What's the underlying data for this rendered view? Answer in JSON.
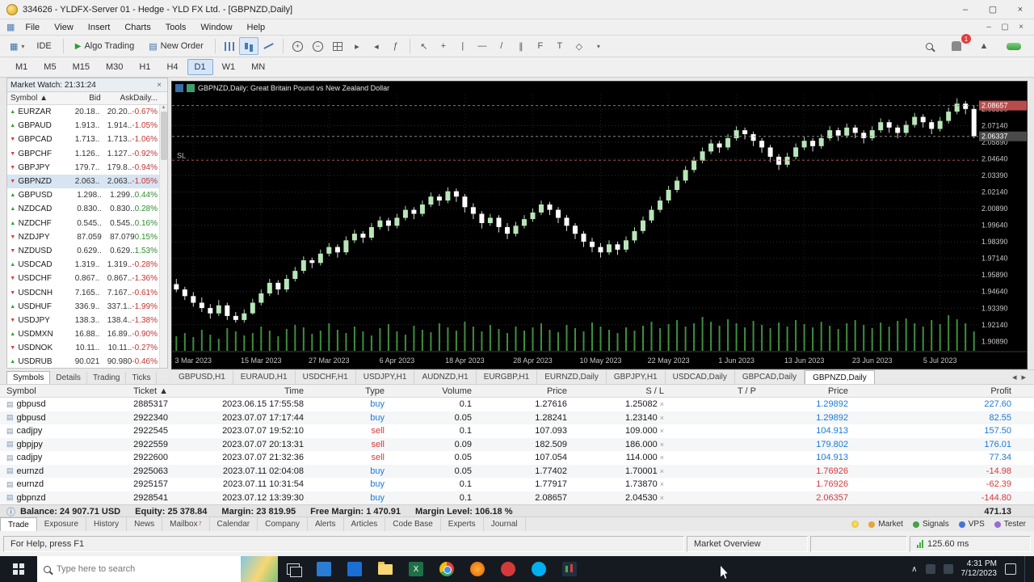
{
  "window": {
    "title": "334626 - YLDFX-Server 01 - Hedge - YLD FX Ltd. - [GBPNZD,Daily]"
  },
  "icons": {
    "min": "–",
    "max": "▢",
    "close": "×",
    "dropdown": "▾",
    "up": "▲",
    "down": "▼",
    "left": "◂",
    "right": "▸",
    "cursor": "↖",
    "cross": "+",
    "vline": "|",
    "hline": "—",
    "trend": "/",
    "channel": "∥",
    "fibo": "F",
    "text": "T",
    "shapes": "◇",
    "chart_new": "▦",
    "order_doc": "▤",
    "play": "▶",
    "func": "ƒ",
    "chevron_up": "∧"
  },
  "menu": {
    "items": [
      "File",
      "View",
      "Insert",
      "Charts",
      "Tools",
      "Window",
      "Help"
    ]
  },
  "toolbar": {
    "ide_label": "IDE",
    "algo_label": "Algo Trading",
    "order_label": "New Order",
    "badge": "1"
  },
  "timeframes": {
    "items": [
      "M1",
      "M5",
      "M15",
      "M30",
      "H1",
      "H4",
      "D1",
      "W1",
      "MN"
    ],
    "active": "D1"
  },
  "market_watch": {
    "title": "Market Watch: 21:31:24",
    "columns": [
      "Symbol ▲",
      "Bid",
      "Ask",
      "Daily..."
    ],
    "selected": "GBPNZD",
    "rows": [
      {
        "symbol": "EURZAR",
        "bid": "20.18..",
        "ask": "20.20..",
        "daily": "-0.67%",
        "dir": "up"
      },
      {
        "symbol": "GBPAUD",
        "bid": "1.913..",
        "ask": "1.914..",
        "daily": "-1.05%",
        "dir": "up"
      },
      {
        "symbol": "GBPCAD",
        "bid": "1.713..",
        "ask": "1.713..",
        "daily": "-1.06%",
        "dir": "down"
      },
      {
        "symbol": "GBPCHF",
        "bid": "1.126..",
        "ask": "1.127..",
        "daily": "-0.92%",
        "dir": "down"
      },
      {
        "symbol": "GBPJPY",
        "bid": "179.7..",
        "ask": "179.8..",
        "daily": "-0.94%",
        "dir": "down"
      },
      {
        "symbol": "GBPNZD",
        "bid": "2.063..",
        "ask": "2.063..",
        "daily": "-1.05%",
        "dir": "down"
      },
      {
        "symbol": "GBPUSD",
        "bid": "1.298..",
        "ask": "1.299..",
        "daily": "0.44%",
        "dir": "up"
      },
      {
        "symbol": "NZDCAD",
        "bid": "0.830..",
        "ask": "0.830..",
        "daily": "0.28%",
        "dir": "up"
      },
      {
        "symbol": "NZDCHF",
        "bid": "0.545..",
        "ask": "0.545..",
        "daily": "0.16%",
        "dir": "up"
      },
      {
        "symbol": "NZDJPY",
        "bid": "87.059",
        "ask": "87.079",
        "daily": "0.15%",
        "dir": "down"
      },
      {
        "symbol": "NZDUSD",
        "bid": "0.629..",
        "ask": "0.629..",
        "daily": "1.53%",
        "dir": "down"
      },
      {
        "symbol": "USDCAD",
        "bid": "1.319..",
        "ask": "1.319..",
        "daily": "-0.28%",
        "dir": "up"
      },
      {
        "symbol": "USDCHF",
        "bid": "0.867..",
        "ask": "0.867..",
        "daily": "-1.36%",
        "dir": "down"
      },
      {
        "symbol": "USDCNH",
        "bid": "7.165..",
        "ask": "7.167..",
        "daily": "-0.61%",
        "dir": "down"
      },
      {
        "symbol": "USDHUF",
        "bid": "336.9..",
        "ask": "337.1..",
        "daily": "-1.99%",
        "dir": "up"
      },
      {
        "symbol": "USDJPY",
        "bid": "138.3..",
        "ask": "138.4..",
        "daily": "-1.38%",
        "dir": "down"
      },
      {
        "symbol": "USDMXN",
        "bid": "16.88..",
        "ask": "16.89..",
        "daily": "-0.90%",
        "dir": "up"
      },
      {
        "symbol": "USDNOK",
        "bid": "10.11..",
        "ask": "10.11..",
        "daily": "-0.27%",
        "dir": "down"
      },
      {
        "symbol": "USDRUB",
        "bid": "90.021",
        "ask": "90.980",
        "daily": "-0.46%",
        "dir": "up"
      }
    ],
    "tabs": [
      "Symbols",
      "Details",
      "Trading",
      "Ticks"
    ],
    "active_tab": "Symbols"
  },
  "chart": {
    "window_title": "GBPNZD,Daily:  Great Britain Pound vs New Zealand Dollar"
  },
  "chart_tabs": {
    "items": [
      "GBPUSD,H1",
      "EURAUD,H1",
      "USDCHF,H1",
      "USDJPY,H1",
      "AUDNZD,H1",
      "EURGBP,H1",
      "EURNZD,Daily",
      "GBPJPY,H1",
      "USDCAD,Daily",
      "GBPCAD,Daily",
      "GBPNZD,Daily"
    ],
    "active": "GBPNZD,Daily"
  },
  "chart_data": {
    "type": "candlestick",
    "title": "GBPNZD,Daily: Great Britain Pound vs New Zealand Dollar",
    "symbol": "GBPNZD",
    "period": "Daily",
    "xlabel": "",
    "ylabel": "",
    "ylim": [
      1.903,
      2.093
    ],
    "grid": true,
    "price_labels": [
      "2.08390",
      "2.07140",
      "2.05890",
      "2.04640",
      "2.03390",
      "2.02140",
      "2.00890",
      "1.99640",
      "1.98390",
      "1.97140",
      "1.95890",
      "1.94640",
      "1.93390",
      "1.92140",
      "1.90890"
    ],
    "date_labels": [
      {
        "i": 2,
        "t": "3 Mar 2023"
      },
      {
        "i": 10,
        "t": "15 Mar 2023"
      },
      {
        "i": 18,
        "t": "27 Mar 2023"
      },
      {
        "i": 26,
        "t": "6 Apr 2023"
      },
      {
        "i": 34,
        "t": "18 Apr 2023"
      },
      {
        "i": 42,
        "t": "28 Apr 2023"
      },
      {
        "i": 50,
        "t": "10 May 2023"
      },
      {
        "i": 58,
        "t": "22 May 2023"
      },
      {
        "i": 66,
        "t": "1 Jun 2023"
      },
      {
        "i": 74,
        "t": "13 Jun 2023"
      },
      {
        "i": 82,
        "t": "23 Jun 2023"
      },
      {
        "i": 90,
        "t": "5 Jul 2023"
      }
    ],
    "ohlc": [
      [
        1.952,
        1.956,
        1.946,
        1.948
      ],
      [
        1.948,
        1.95,
        1.94,
        1.943
      ],
      [
        1.943,
        1.946,
        1.935,
        1.938
      ],
      [
        1.938,
        1.942,
        1.931,
        1.934
      ],
      [
        1.934,
        1.937,
        1.926,
        1.93
      ],
      [
        1.93,
        1.94,
        1.928,
        1.936
      ],
      [
        1.936,
        1.938,
        1.925,
        1.928
      ],
      [
        1.928,
        1.931,
        1.923,
        1.925
      ],
      [
        1.925,
        1.933,
        1.923,
        1.93
      ],
      [
        1.93,
        1.941,
        1.929,
        1.938
      ],
      [
        1.938,
        1.948,
        1.936,
        1.945
      ],
      [
        1.945,
        1.956,
        1.943,
        1.953
      ],
      [
        1.953,
        1.955,
        1.944,
        1.948
      ],
      [
        1.948,
        1.959,
        1.946,
        1.956
      ],
      [
        1.956,
        1.965,
        1.954,
        1.962
      ],
      [
        1.962,
        1.973,
        1.96,
        1.97
      ],
      [
        1.97,
        1.972,
        1.964,
        1.968
      ],
      [
        1.968,
        1.978,
        1.966,
        1.975
      ],
      [
        1.975,
        1.983,
        1.973,
        1.98
      ],
      [
        1.98,
        1.982,
        1.972,
        1.976
      ],
      [
        1.976,
        1.988,
        1.974,
        1.985
      ],
      [
        1.985,
        1.993,
        1.983,
        1.99
      ],
      [
        1.99,
        1.992,
        1.983,
        1.987
      ],
      [
        1.987,
        1.998,
        1.985,
        1.995
      ],
      [
        1.995,
        2.003,
        1.993,
        2.0
      ],
      [
        2.0,
        2.002,
        1.992,
        1.996
      ],
      [
        1.996,
        2.005,
        1.994,
        2.002
      ],
      [
        2.002,
        2.011,
        2.0,
        2.008
      ],
      [
        2.008,
        2.01,
        2.001,
        2.005
      ],
      [
        2.005,
        2.015,
        2.003,
        2.012
      ],
      [
        2.012,
        2.021,
        2.01,
        2.018
      ],
      [
        2.018,
        2.02,
        2.011,
        2.015
      ],
      [
        2.015,
        2.025,
        2.013,
        2.022
      ],
      [
        2.022,
        2.024,
        2.014,
        2.018
      ],
      [
        2.018,
        2.02,
        2.006,
        2.01
      ],
      [
        2.01,
        2.013,
        2.001,
        2.005
      ],
      [
        2.005,
        2.007,
        1.994,
        1.998
      ],
      [
        1.998,
        2.005,
        1.996,
        2.002
      ],
      [
        2.002,
        2.004,
        1.991,
        1.995
      ],
      [
        1.995,
        1.998,
        1.986,
        1.99
      ],
      [
        1.99,
        1.999,
        1.988,
        1.996
      ],
      [
        1.996,
        2.004,
        1.994,
        2.001
      ],
      [
        2.001,
        2.009,
        1.999,
        2.006
      ],
      [
        2.006,
        2.015,
        2.004,
        2.012
      ],
      [
        2.012,
        2.014,
        2.004,
        2.008
      ],
      [
        2.008,
        2.01,
        1.998,
        2.002
      ],
      [
        2.002,
        2.004,
        1.992,
        1.996
      ],
      [
        1.996,
        1.998,
        1.986,
        1.99
      ],
      [
        1.99,
        1.992,
        1.98,
        1.984
      ],
      [
        1.984,
        1.987,
        1.976,
        1.98
      ],
      [
        1.98,
        1.983,
        1.972,
        1.976
      ],
      [
        1.976,
        1.985,
        1.974,
        1.982
      ],
      [
        1.982,
        1.984,
        1.974,
        1.978
      ],
      [
        1.978,
        1.988,
        1.976,
        1.985
      ],
      [
        1.985,
        1.995,
        1.983,
        1.992
      ],
      [
        1.992,
        2.003,
        1.99,
        2.0
      ],
      [
        2.0,
        2.011,
        1.998,
        2.008
      ],
      [
        2.008,
        2.018,
        2.006,
        2.015
      ],
      [
        2.015,
        2.026,
        2.013,
        2.023
      ],
      [
        2.023,
        2.033,
        2.021,
        2.03
      ],
      [
        2.03,
        2.041,
        2.028,
        2.038
      ],
      [
        2.038,
        2.048,
        2.036,
        2.045
      ],
      [
        2.045,
        2.055,
        2.043,
        2.052
      ],
      [
        2.052,
        2.061,
        2.05,
        2.058
      ],
      [
        2.058,
        2.06,
        2.051,
        2.055
      ],
      [
        2.055,
        2.065,
        2.053,
        2.062
      ],
      [
        2.062,
        2.071,
        2.06,
        2.068
      ],
      [
        2.068,
        2.07,
        2.061,
        2.065
      ],
      [
        2.065,
        2.067,
        2.056,
        2.06
      ],
      [
        2.06,
        2.062,
        2.051,
        2.055
      ],
      [
        2.055,
        2.057,
        2.044,
        2.048
      ],
      [
        2.048,
        2.05,
        2.038,
        2.042
      ],
      [
        2.042,
        2.051,
        2.04,
        2.048
      ],
      [
        2.048,
        2.058,
        2.046,
        2.055
      ],
      [
        2.055,
        2.063,
        2.053,
        2.06
      ],
      [
        2.06,
        2.062,
        2.052,
        2.056
      ],
      [
        2.056,
        2.065,
        2.054,
        2.062
      ],
      [
        2.062,
        2.071,
        2.06,
        2.068
      ],
      [
        2.068,
        2.07,
        2.06,
        2.064
      ],
      [
        2.064,
        2.073,
        2.062,
        2.07
      ],
      [
        2.07,
        2.072,
        2.062,
        2.066
      ],
      [
        2.066,
        2.068,
        2.058,
        2.062
      ],
      [
        2.062,
        2.071,
        2.06,
        2.068
      ],
      [
        2.068,
        2.077,
        2.066,
        2.074
      ],
      [
        2.074,
        2.076,
        2.066,
        2.07
      ],
      [
        2.07,
        2.072,
        2.062,
        2.066
      ],
      [
        2.066,
        2.075,
        2.064,
        2.072
      ],
      [
        2.072,
        2.081,
        2.07,
        2.078
      ],
      [
        2.078,
        2.08,
        2.07,
        2.074
      ],
      [
        2.074,
        2.076,
        2.065,
        2.069
      ],
      [
        2.069,
        2.078,
        2.067,
        2.075
      ],
      [
        2.075,
        2.085,
        2.073,
        2.082
      ],
      [
        2.082,
        2.092,
        2.08,
        2.088
      ],
      [
        2.088,
        2.09,
        2.08,
        2.084
      ],
      [
        2.084,
        2.087,
        2.062,
        2.0634
      ]
    ],
    "volumes": [
      900,
      1100,
      850,
      1300,
      1000,
      750,
      1400,
      1200,
      950,
      1100,
      1500,
      1250,
      900,
      1350,
      1600,
      1450,
      1050,
      1250,
      1700,
      1300,
      1100,
      1500,
      1200,
      950,
      1400,
      1650,
      1200,
      1000,
      1550,
      1300,
      1150,
      1700,
      1450,
      1250,
      1800,
      1500,
      1200,
      1600,
      1350,
      1100,
      1500,
      1250,
      1450,
      1700,
      1300,
      1150,
      1600,
      1400,
      1200,
      1750,
      1500,
      1300,
      1100,
      1450,
      1250,
      1550,
      1800,
      1400,
      1650,
      1900,
      1500,
      1700,
      2100,
      1800,
      1550,
      1950,
      1700,
      1450,
      1850,
      1600,
      1400,
      1750,
      1500,
      1900,
      1650,
      1450,
      1800,
      1550,
      1350,
      1700,
      1900,
      1600,
      1400,
      1750,
      1500,
      1850,
      2000,
      1700,
      1500,
      1900,
      1650,
      2200,
      1950,
      1700,
      1200
    ],
    "lines": [
      {
        "price": 2.08657,
        "color": "#4aa04a",
        "label": ""
      },
      {
        "price": 2.0453,
        "color": "#a05050",
        "label": "SL"
      },
      {
        "price": 2.06337,
        "color": "#888888",
        "label": ""
      }
    ],
    "axis_tags": [
      {
        "text": "2.06337",
        "bg": "#4a4a4a"
      },
      {
        "text": "2.08657",
        "bg": "#b84d4d"
      }
    ],
    "legend_position": "none"
  },
  "toolbox": {
    "columns": [
      "Symbol",
      "Ticket ▲",
      "Time",
      "Type",
      "Volume",
      "Price",
      "S / L",
      "T / P",
      "Price",
      "Profit"
    ],
    "positions": [
      {
        "symbol": "gbpusd",
        "ticket": "2885317",
        "time": "2023.06.15 17:55:58",
        "type": "buy",
        "volume": "0.1",
        "price": "1.27616",
        "sl": "1.25082",
        "tp": "",
        "price2": "1.29892",
        "profit": "227.60"
      },
      {
        "symbol": "gbpusd",
        "ticket": "2922340",
        "time": "2023.07.07 17:17:44",
        "type": "buy",
        "volume": "0.05",
        "price": "1.28241",
        "sl": "1.23140",
        "tp": "",
        "price2": "1.29892",
        "profit": "82.55"
      },
      {
        "symbol": "cadjpy",
        "ticket": "2922545",
        "time": "2023.07.07 19:52:10",
        "type": "sell",
        "volume": "0.1",
        "price": "107.093",
        "sl": "109.000",
        "tp": "",
        "price2": "104.913",
        "profit": "157.50"
      },
      {
        "symbol": "gbpjpy",
        "ticket": "2922559",
        "time": "2023.07.07 20:13:31",
        "type": "sell",
        "volume": "0.09",
        "price": "182.509",
        "sl": "186.000",
        "tp": "",
        "price2": "179.802",
        "profit": "176.01"
      },
      {
        "symbol": "cadjpy",
        "ticket": "2922600",
        "time": "2023.07.07 21:32:36",
        "type": "sell",
        "volume": "0.05",
        "price": "107.054",
        "sl": "114.000",
        "tp": "",
        "price2": "104.913",
        "profit": "77.34"
      },
      {
        "symbol": "eurnzd",
        "ticket": "2925063",
        "time": "2023.07.11 02:04:08",
        "type": "buy",
        "volume": "0.05",
        "price": "1.77402",
        "sl": "1.70001",
        "tp": "",
        "price2": "1.76926",
        "profit": "-14.98"
      },
      {
        "symbol": "eurnzd",
        "ticket": "2925157",
        "time": "2023.07.11 10:31:54",
        "type": "buy",
        "volume": "0.1",
        "price": "1.77917",
        "sl": "1.73870",
        "tp": "",
        "price2": "1.76926",
        "profit": "-62.39"
      },
      {
        "symbol": "gbpnzd",
        "ticket": "2928541",
        "time": "2023.07.12 13:39:30",
        "type": "buy",
        "volume": "0.1",
        "price": "2.08657",
        "sl": "2.04530",
        "tp": "",
        "price2": "2.06357",
        "profit": "-144.80"
      }
    ],
    "balance_items": [
      "Balance: 24 907.71 USD",
      "Equity: 25 378.84",
      "Margin: 23 819.95",
      "Free Margin: 1 470.91",
      "Margin Level: 106.18 %"
    ],
    "total_profit": "471.13",
    "tabs": [
      "Trade",
      "Exposure",
      "History",
      "News",
      "Mailbox",
      "Calendar",
      "Company",
      "Alerts",
      "Articles",
      "Code Base",
      "Experts",
      "Journal"
    ],
    "mailbox_count": "7",
    "active_tab": "Trade",
    "right_buttons": [
      {
        "label": "Market",
        "color": "#e8a33d"
      },
      {
        "label": "Signals",
        "color": "#46a046"
      },
      {
        "label": "VPS",
        "color": "#4673d1"
      },
      {
        "label": "Tester",
        "color": "#9a6ad1"
      }
    ]
  },
  "status_bar": {
    "help": "For Help, press F1",
    "overview": "Market Overview",
    "latency": "125.60 ms"
  },
  "taskbar": {
    "search_placeholder": "Type here to search",
    "time": "4:31 PM",
    "date": "7/12/2023"
  }
}
